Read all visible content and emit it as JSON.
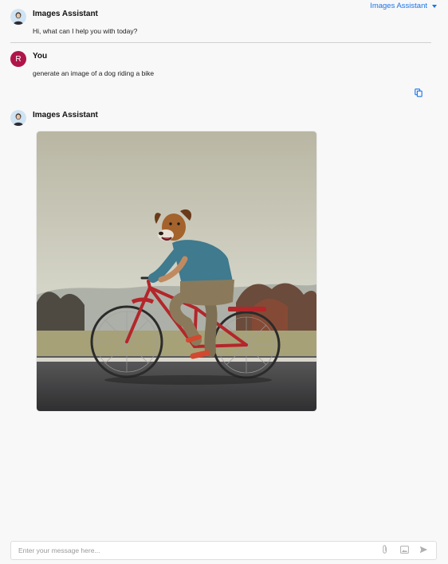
{
  "header": {
    "assistant_selector_label": "Images Assistant",
    "assistant_selector_icon": "chevron-down-icon"
  },
  "messages": [
    {
      "sender": "Images Assistant",
      "avatar_icon": "assistant-avatar-icon",
      "text": "Hi, what can I help you with today?"
    },
    {
      "sender": "You",
      "avatar_initial": "R",
      "avatar_color": "#b0154a",
      "text": "generate an image of a dog riding a bike",
      "action_icon": "copy-icon"
    },
    {
      "sender": "Images Assistant",
      "avatar_icon": "assistant-avatar-icon",
      "image_icon": "generated-dog-riding-bike-image"
    }
  ],
  "composer": {
    "placeholder": "Enter your message here...",
    "attach_icon": "paperclip-icon",
    "image_icon": "image-icon",
    "send_icon": "send-icon"
  },
  "colors": {
    "accent": "#1a73e8",
    "background": "#f8f8f8",
    "divider": "#d0d0d0",
    "user_avatar": "#b0154a"
  }
}
